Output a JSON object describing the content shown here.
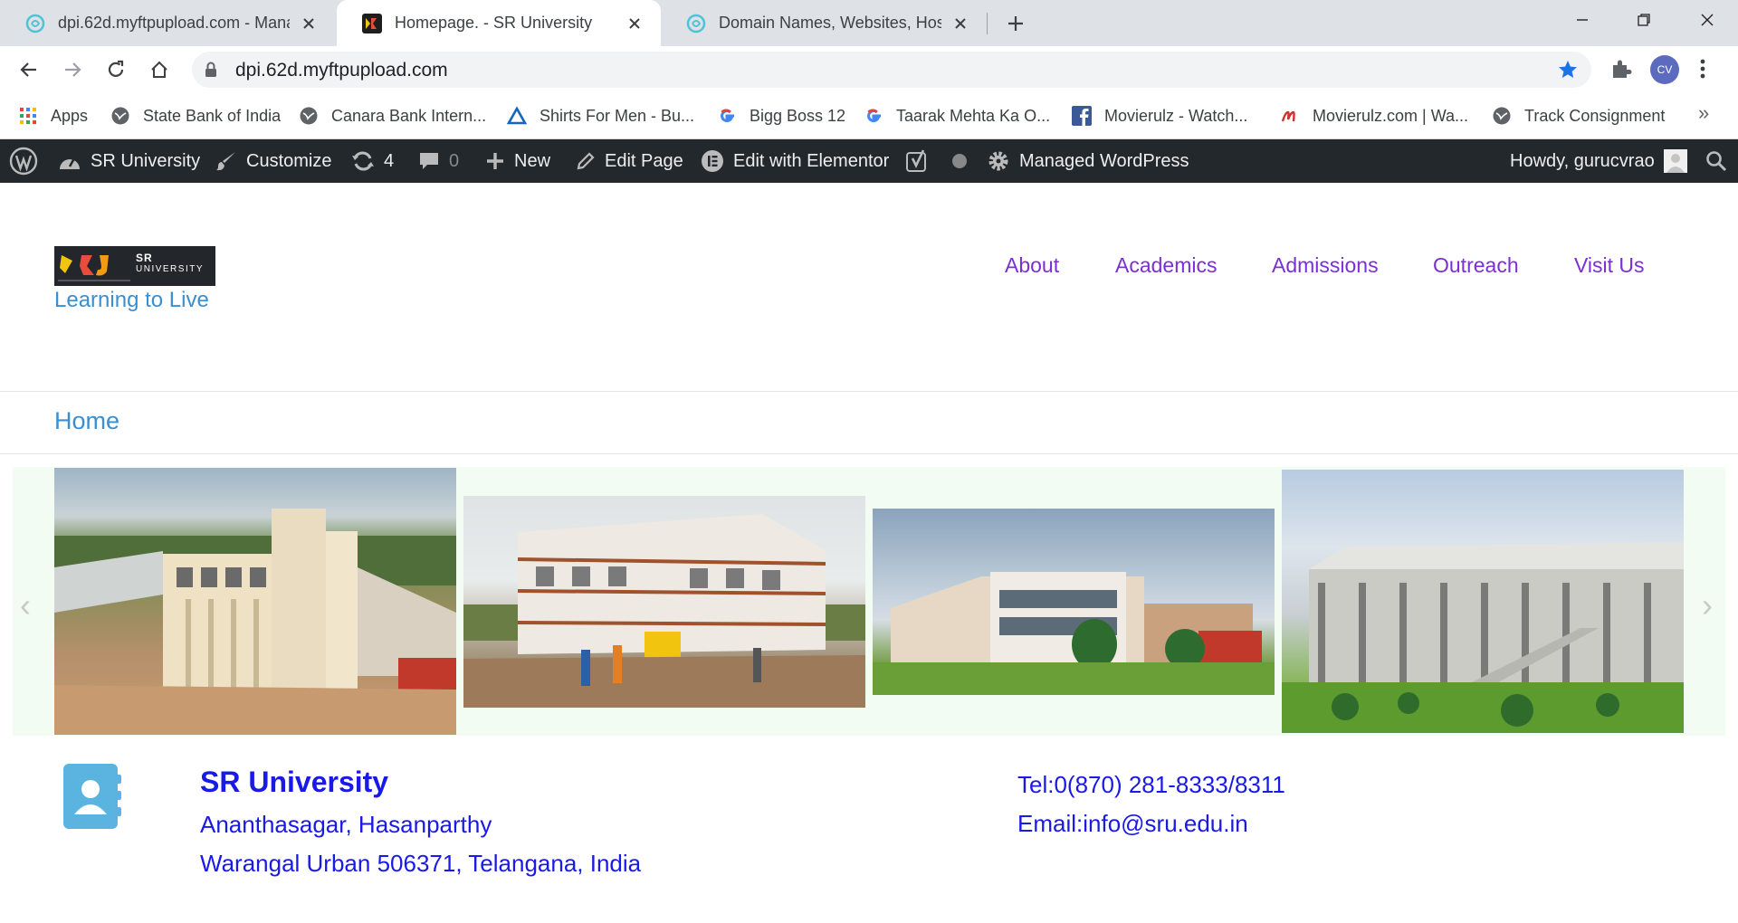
{
  "browser": {
    "tabs": [
      {
        "title": "dpi.62d.myftpupload.com - Mana",
        "active": false
      },
      {
        "title": "Homepage. - SR University",
        "active": true
      },
      {
        "title": "Domain Names, Websites, Hostin",
        "active": false
      }
    ],
    "url": "dpi.62d.myftpupload.com",
    "profile_initials": "CV",
    "bookmarks": [
      {
        "label": "Apps",
        "icon": "apps-grid-icon"
      },
      {
        "label": "State Bank of India",
        "icon": "globe-icon"
      },
      {
        "label": "Canara Bank Intern...",
        "icon": "globe-icon"
      },
      {
        "label": "Shirts For Men - Bu...",
        "icon": "triangle-icon"
      },
      {
        "label": "Bigg Boss 12",
        "icon": "google-icon"
      },
      {
        "label": "Taarak Mehta Ka O...",
        "icon": "google-icon"
      },
      {
        "label": "Movierulz - Watch...",
        "icon": "facebook-icon"
      },
      {
        "label": "Movierulz.com | Wa...",
        "icon": "movierulz-icon"
      },
      {
        "label": "Track Consignment",
        "icon": "globe-icon"
      }
    ],
    "bookmarks_more": "»"
  },
  "adminbar": {
    "site": "SR University",
    "customize": "Customize",
    "updates": "4",
    "comments": "0",
    "new": "New",
    "edit_page": "Edit Page",
    "elementor": "Edit with Elementor",
    "managed": "Managed WordPress",
    "howdy": "Howdy, gurucvrao"
  },
  "site": {
    "logo_text_1": "SR",
    "logo_text_2": "UNIVERSITY",
    "tagline": "Learning to Live",
    "nav": [
      "About",
      "Academics",
      "Admissions",
      "Outreach",
      "Visit Us"
    ],
    "breadcrumb": "Home"
  },
  "slider": {
    "prev": "‹",
    "next": "›"
  },
  "contact": {
    "name": "SR University",
    "address_line1": "Ananthasagar, Hasanparthy",
    "address_line2": "Warangal Urban 506371, Telangana, India",
    "tel": "Tel:0(870) 281-8333/8311",
    "email": "Email:info@sru.edu.in"
  },
  "colors": {
    "admin_bar": "#23282d",
    "nav_link": "#7b2fd4",
    "tagline": "#3a8fd1",
    "contact_text": "#1a1ae6"
  }
}
